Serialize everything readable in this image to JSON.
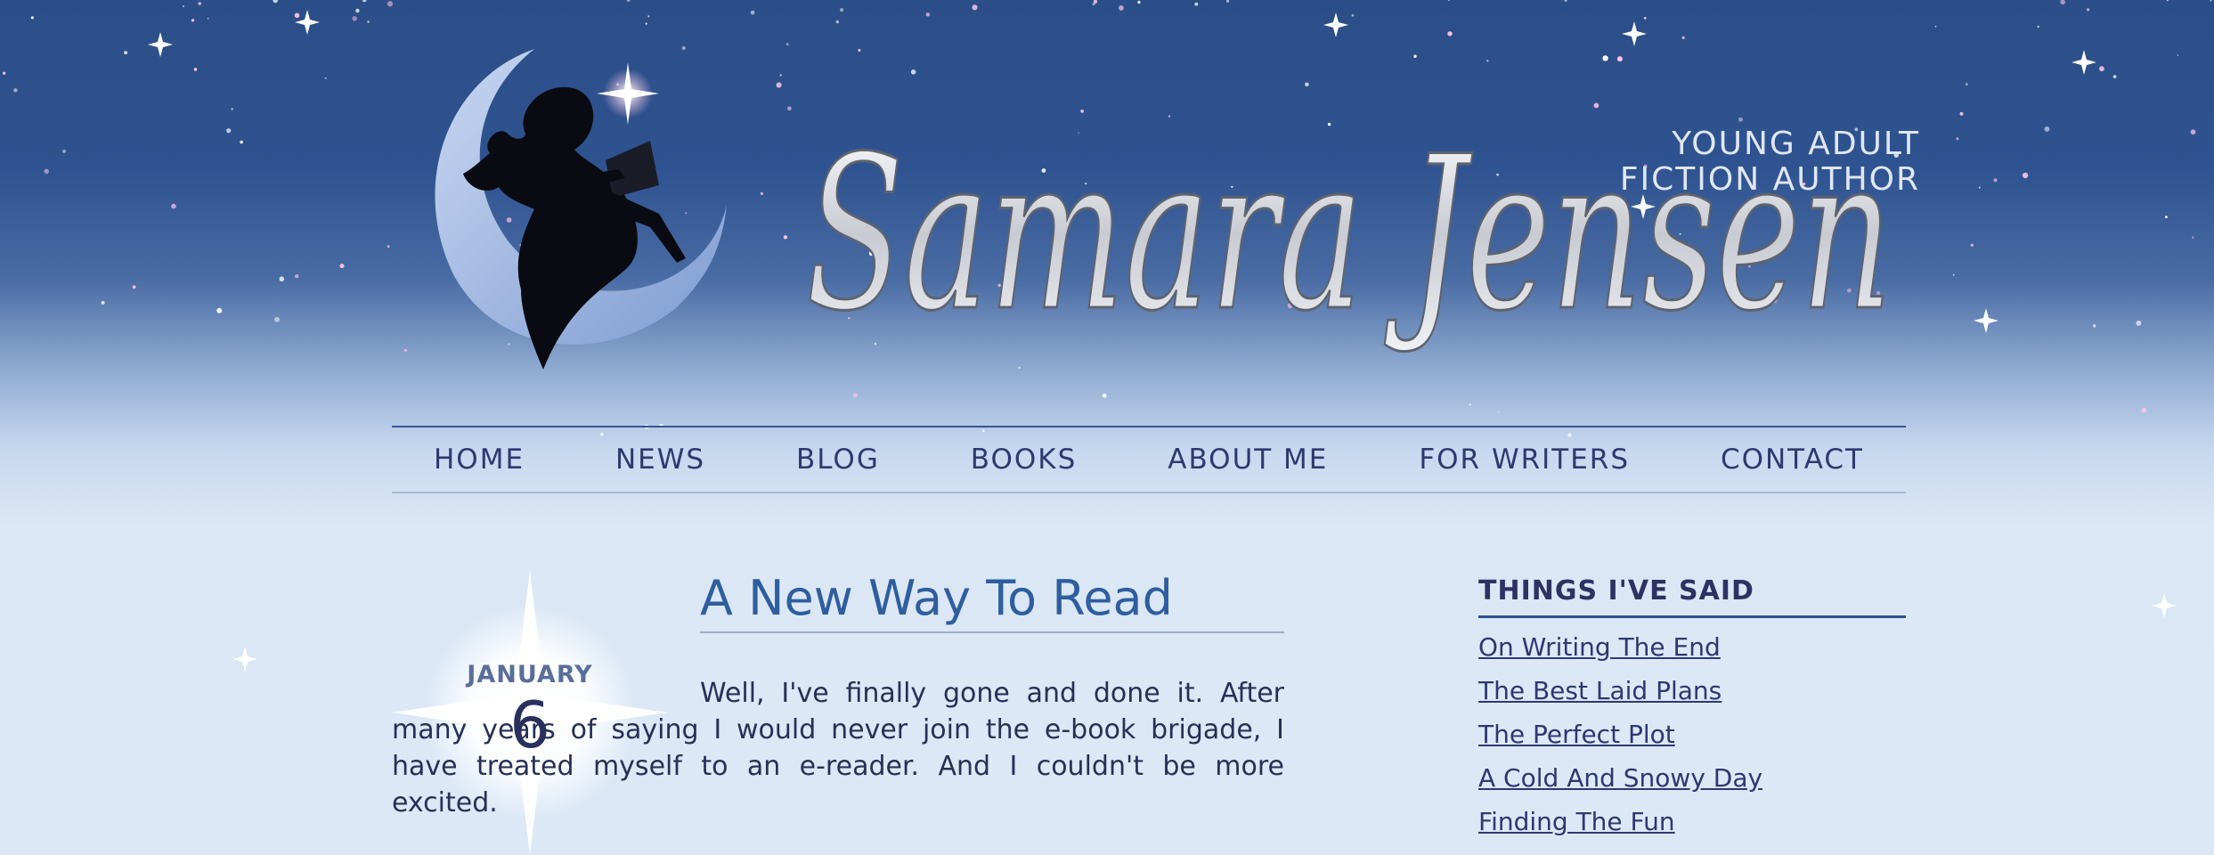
{
  "header": {
    "author_name": "Samara Jensen",
    "tagline_line1": "YOUNG ADULT",
    "tagline_line2": "FICTION AUTHOR"
  },
  "nav": {
    "items": [
      "HOME",
      "NEWS",
      "BLOG",
      "BOOKS",
      "ABOUT ME",
      "FOR WRITERS",
      "CONTACT"
    ]
  },
  "post": {
    "month": "JANUARY",
    "day": "6",
    "title": "A New Way To Read",
    "body": "Well, I've finally gone and done it. After many years of saying I would never join the e-book brigade, I have treated myself to an e-reader. And I couldn't be more excited."
  },
  "sidebar": {
    "title": "THINGS I'VE SAID",
    "links": [
      "On Writing The End",
      "The Best Laid Plans",
      "The Perfect Plot",
      "A Cold And Snowy Day",
      "Finding The Fun"
    ]
  },
  "colors": {
    "sky_top": "#2c4e88",
    "sky_bottom": "#dce8f6",
    "nav_text": "#2e3a6e",
    "title_blue": "#2f5e9e",
    "body_text": "#283055"
  },
  "icons": [
    "crescent-moon-icon",
    "girl-reading-silhouette-icon",
    "star-sparkle-icon"
  ]
}
